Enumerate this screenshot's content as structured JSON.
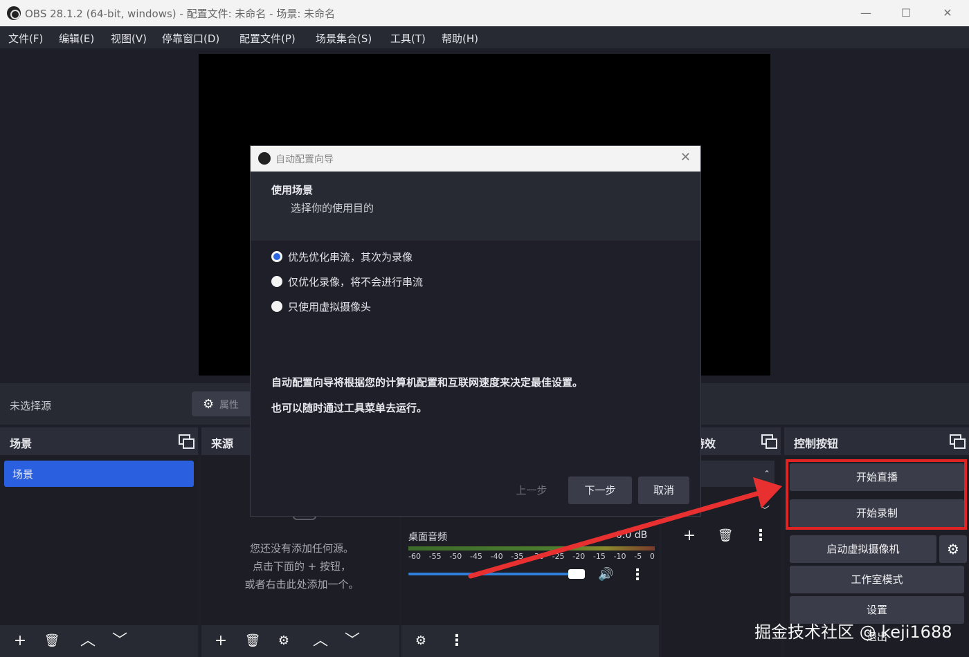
{
  "window": {
    "title": "OBS 28.1.2 (64-bit, windows) - 配置文件: 未命名 - 场景: 未命名",
    "minimize": "—",
    "maximize": "☐",
    "close": "✕"
  },
  "menu": [
    "文件(F)",
    "编辑(E)",
    "视图(V)",
    "停靠窗口(D)",
    "配置文件(P)",
    "场景集合(S)",
    "工具(T)",
    "帮助(H)"
  ],
  "source_toolbar": {
    "no_source": "未选择源",
    "properties": "属性"
  },
  "docks": {
    "scenes": {
      "title": "场景",
      "items": [
        "场景"
      ]
    },
    "sources": {
      "title": "来源",
      "hint": "您还没有添加任何源。",
      "hint2": "点击下面的 + 按钮，",
      "hint3": "或者右击此处添加一个。"
    },
    "mixer": {
      "channel": "桌面音频",
      "db": "0.0 dB",
      "ticks": [
        "-60",
        "-55",
        "-50",
        "-45",
        "-40",
        "-35",
        "-30",
        "-25",
        "-20",
        "-15",
        "-10",
        "-5",
        "0"
      ],
      "volume_fraction": 0.95
    },
    "transitions": {
      "title": "转场特效"
    },
    "controls": {
      "title": "控制按钮",
      "start_stream": "开始直播",
      "start_record": "开始录制",
      "virtual_cam": "启动虚拟摄像机",
      "studio_mode": "工作室模式",
      "settings": "设置",
      "exit": "退出"
    }
  },
  "dialog": {
    "title": "自动配置向导",
    "page_title": "使用场景",
    "page_sub": "选择你的使用目的",
    "options": [
      {
        "label": "优先优化串流，其次为录像",
        "checked": true
      },
      {
        "label": "仅优化录像，将不会进行串流",
        "checked": false
      },
      {
        "label": "只使用虚拟摄像头",
        "checked": false
      }
    ],
    "desc1": "自动配置向导将根据您的计算机配置和互联网速度来决定最佳设置。",
    "desc2": "也可以随时通过工具菜单去运行。",
    "back": "上一步",
    "next": "下一步",
    "cancel": "取消"
  },
  "watermark": "掘金技术社区 @ keji1688",
  "colors": {
    "accent": "#2a5fe0",
    "highlight": "#e02424"
  }
}
